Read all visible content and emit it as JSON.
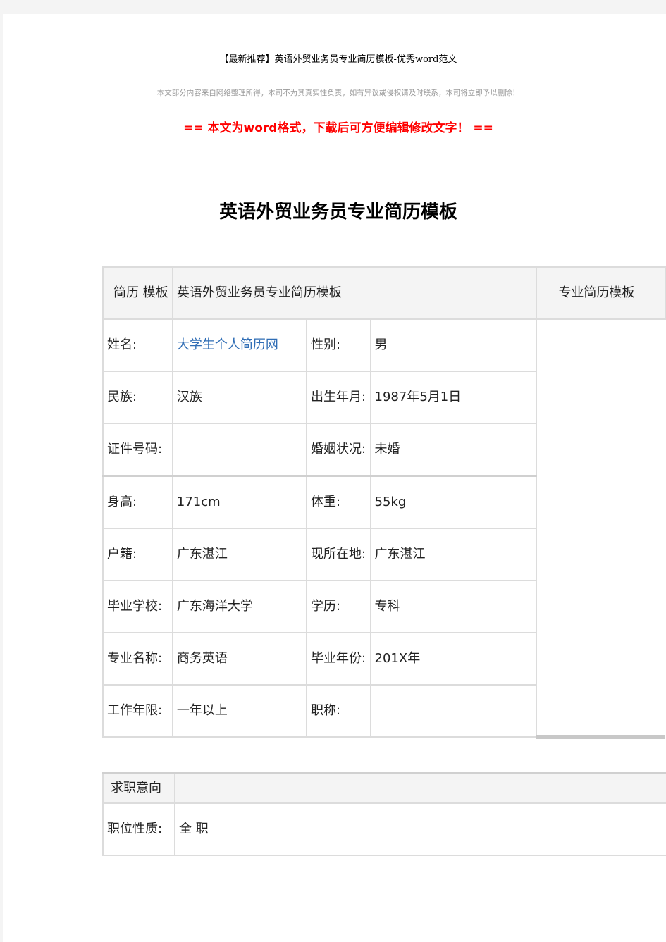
{
  "header": {
    "title": "【最新推荐】英语外贸业务员专业简历模板-优秀word范文",
    "disclaimer": "本文部分内容来自网络整理所得，本司不为其真实性负责，如有异议或侵权请及时联系，本司将立即予以删除！",
    "notice": "== 本文为word格式，下载后可方便编辑修改文字！ =="
  },
  "document": {
    "title": "英语外贸业务员专业简历模板"
  },
  "basic_info": {
    "head_label": "简历 模板",
    "head_value": "英语外贸业务员专业简历模板",
    "photo_label": "专业简历模板",
    "rows": [
      {
        "label1": "姓名:",
        "value1": "大学生个人简历网",
        "label2": "性别:",
        "value2": "男"
      },
      {
        "label1": "民族:",
        "value1": "汉族",
        "label2": "出生年月:",
        "value2": "1987年5月1日"
      },
      {
        "label1": "证件号码:",
        "value1": "",
        "label2": "婚姻状况:",
        "value2": "未婚"
      },
      {
        "label1": "身高:",
        "value1": "171cm",
        "label2": "体重:",
        "value2": "55kg"
      },
      {
        "label1": "户籍:",
        "value1": "广东湛江",
        "label2": "现所在地:",
        "value2": "广东湛江"
      },
      {
        "label1": "毕业学校:",
        "value1": "广东海洋大学",
        "label2": "学历:",
        "value2": "专科"
      },
      {
        "label1": "专业名称:",
        "value1": "商务英语",
        "label2": "毕业年份:",
        "value2": "201X年"
      },
      {
        "label1": "工作年限:",
        "value1": "一年以上",
        "label2": "职称:",
        "value2": ""
      }
    ]
  },
  "job_intention": {
    "head_label": "求职意向",
    "rows": [
      {
        "label": "职位性质:",
        "value": "全 职"
      }
    ]
  },
  "colors": {
    "notice": "#ff0000",
    "link": "#2f6db5",
    "disclaimer": "#9a9a9a"
  }
}
